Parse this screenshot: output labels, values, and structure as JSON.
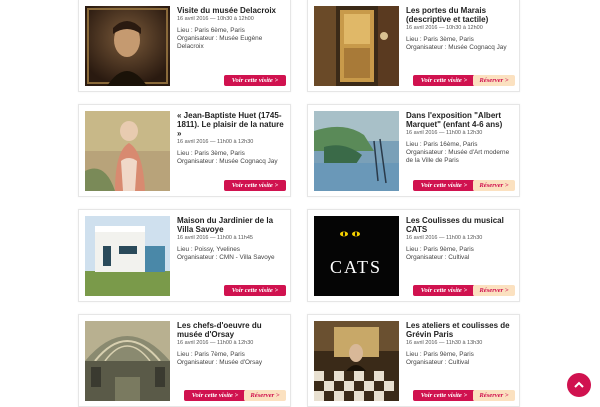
{
  "events": [
    {
      "title": "Visite du musée Delacroix",
      "date": "16 avril 2016 — 10h30 à 12h00",
      "lieu": "Lieu : Paris 6ème, Paris",
      "organisateur": "Organisateur : Musée Eugène Delacroix",
      "visit_label": "Voir cette visite >",
      "reserve_label": ""
    },
    {
      "title": "Les portes du Marais (descriptive et tactile)",
      "date": "16 avril 2016 — 10h30 à 12h00",
      "lieu": "Lieu : Paris 3ème, Paris",
      "organisateur": "Organisateur : Musée Cognacq Jay",
      "visit_label": "Voir cette visite >",
      "reserve_label": "Réserver >"
    },
    {
      "title": "« Jean-Baptiste Huet (1745-1811). Le plaisir de la nature »",
      "date": "16 avril 2016 — 11h00 à 12h30",
      "lieu": "Lieu : Paris 3ème, Paris",
      "organisateur": "Organisateur : Musée Cognacq Jay",
      "visit_label": "Voir cette visite >",
      "reserve_label": ""
    },
    {
      "title": "Dans l'exposition \"Albert Marquet\" (enfant 4-6 ans)",
      "date": "16 avril 2016 — 11h00 à 12h30",
      "lieu": "Lieu : Paris 16ème, Paris",
      "organisateur": "Organisateur : Musée d'Art moderne de la Ville de Paris",
      "visit_label": "Voir cette visite >",
      "reserve_label": "Réserver >"
    },
    {
      "title": "Maison du Jardinier de la Villa Savoye",
      "date": "16 avril 2016 — 11h00 à 11h45",
      "lieu": "Lieu : Poissy, Yvelines",
      "organisateur": "Organisateur : CMN - Villa Savoye",
      "visit_label": "Voir cette visite >",
      "reserve_label": ""
    },
    {
      "title": "Les Coulisses du musical CATS",
      "date": "16 avril 2016 — 11h00 à 12h30",
      "lieu": "Lieu : Paris 9ème, Paris",
      "organisateur": "Organisateur : Cultival",
      "visit_label": "Voir cette visite >",
      "reserve_label": "Réserver >"
    },
    {
      "title": "Les chefs-d'oeuvre du musée d'Orsay",
      "date": "16 avril 2016 — 11h00 à 12h30",
      "lieu": "Lieu : Paris 7ème, Paris",
      "organisateur": "Organisateur : Musée d'Orsay",
      "visit_label": "Voir cette visite >",
      "reserve_label": "Réserver >"
    },
    {
      "title": "Les ateliers et coulisses de Grévin Paris",
      "date": "16 avril 2016 — 11h30 à 13h30",
      "lieu": "Lieu : Paris 9ème, Paris",
      "organisateur": "Organisateur : Cultival",
      "visit_label": "Voir cette visite >",
      "reserve_label": "Réserver >"
    }
  ],
  "cats_logo_text": "CATS",
  "colors": {
    "accent": "#d0124f",
    "reserve_bg": "#fbe1c0"
  },
  "scroll_top_icon": "chevron-up-icon"
}
